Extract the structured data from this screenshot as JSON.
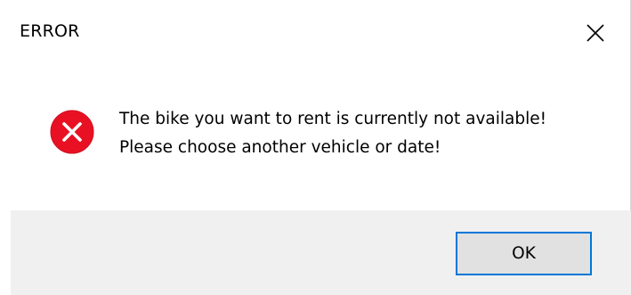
{
  "dialog": {
    "title": "ERROR",
    "message_line1": "The bike you want to rent is currently not available!",
    "message_line2": "Please choose another vehicle or date!",
    "ok_label": "OK",
    "icon": "error-icon",
    "colors": {
      "error_red": "#e81123",
      "accent_blue": "#0078d7",
      "footer_gray": "#f0f0f0",
      "button_gray": "#e1e1e1"
    }
  }
}
